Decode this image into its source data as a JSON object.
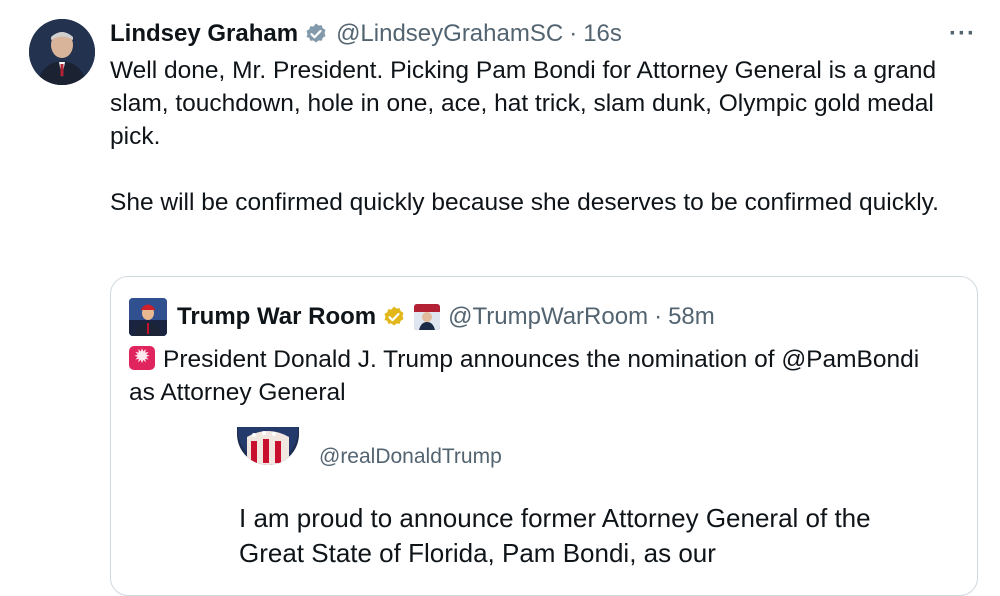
{
  "tweet": {
    "author_name": "Lindsey Graham",
    "handle": "@LindseyGrahamSC",
    "separator": "·",
    "time": "16s",
    "more_label": "···",
    "paragraph1": "Well done, Mr. President. Picking Pam Bondi for Attorney General is a grand slam, touchdown, hole in one, ace, hat trick, slam dunk, Olympic gold medal pick.",
    "paragraph2": "She will be confirmed quickly because she deserves to be confirmed quickly."
  },
  "quoted": {
    "author_name": "Trump War Room",
    "handle": "@TrumpWarRoom",
    "separator": "·",
    "time": "58m",
    "text": "President Donald J. Trump announces the nomination of @PamBondi as Attorney General",
    "emoji_icon": "rotating-light-icon",
    "embedded": {
      "handle": "@realDonaldTrump",
      "text": "I am proud to announce former Attorney General of the Great State of Florida, Pam Bondi, as our"
    }
  },
  "colors": {
    "text": "#0f1419",
    "secondary": "#536471",
    "verified_blue": "#1d9bf0",
    "gold_badge": "#e2b719",
    "border": "#cfd9de",
    "siren": "#e0245e"
  }
}
